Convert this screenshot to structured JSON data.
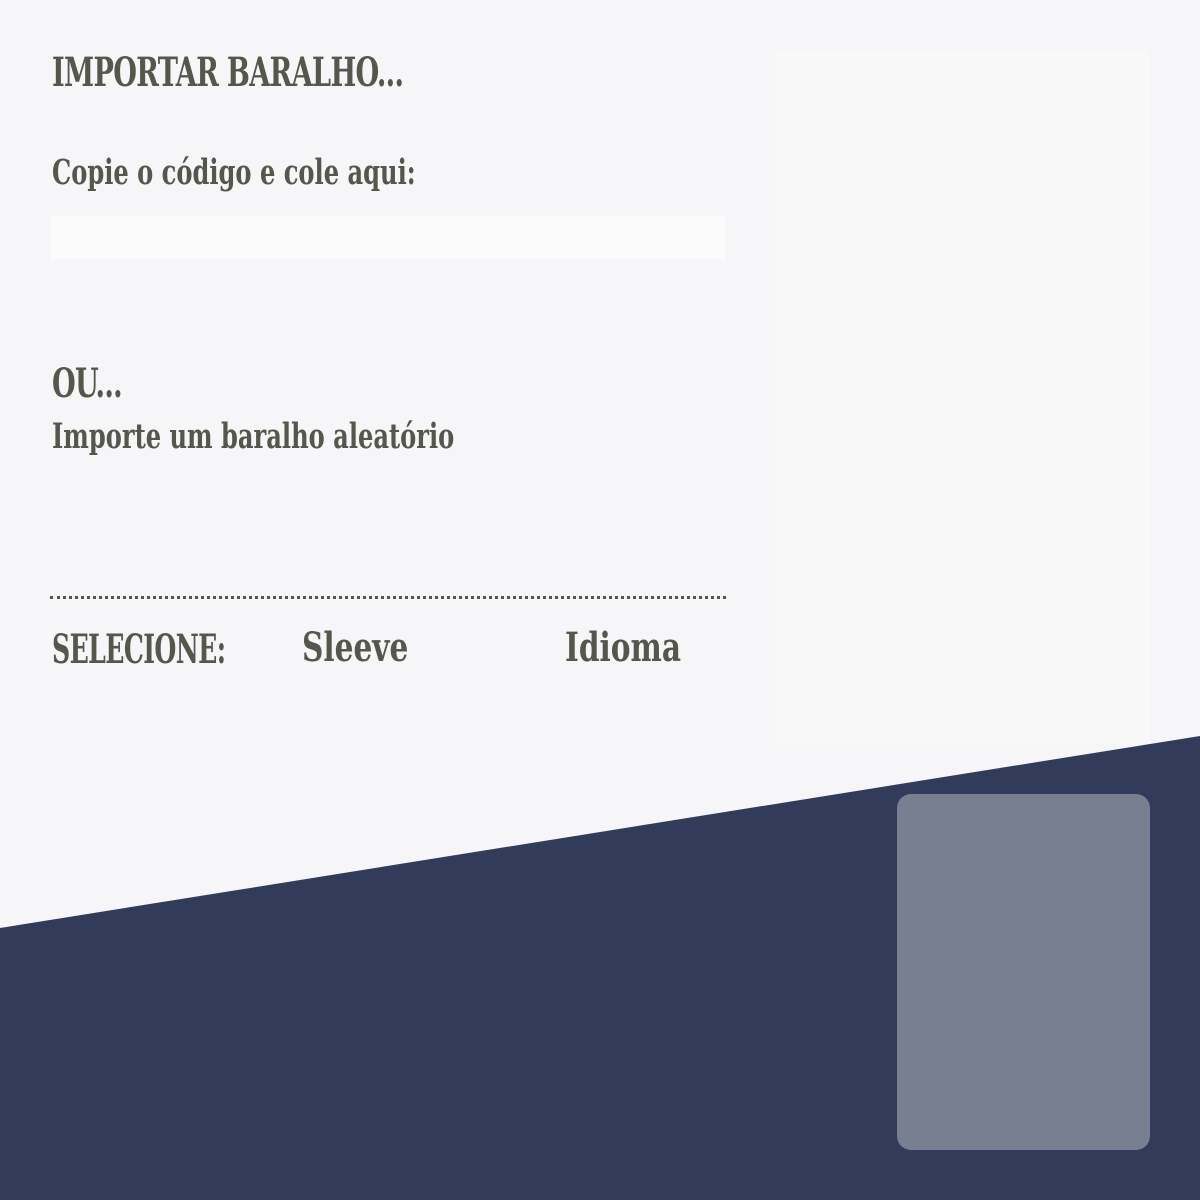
{
  "colors": {
    "background": "#f6f6f8",
    "bottom_band": "#323c5a",
    "card_slot": "#777f91",
    "text": "#55574c",
    "input_bg": "#fbfbfb",
    "panel": "#f8f8f9"
  },
  "import": {
    "title": "IMPORTAR BARALHO...",
    "paste_label": "Copie o código e cole aqui:",
    "code_input": {
      "value": "",
      "placeholder": ""
    }
  },
  "random": {
    "or_title": "OU...",
    "link_label": "Importe um baralho aleatório"
  },
  "selection": {
    "label": "SELECIONE:",
    "sleeve_label": "Sleeve",
    "language_label": "Idioma"
  }
}
